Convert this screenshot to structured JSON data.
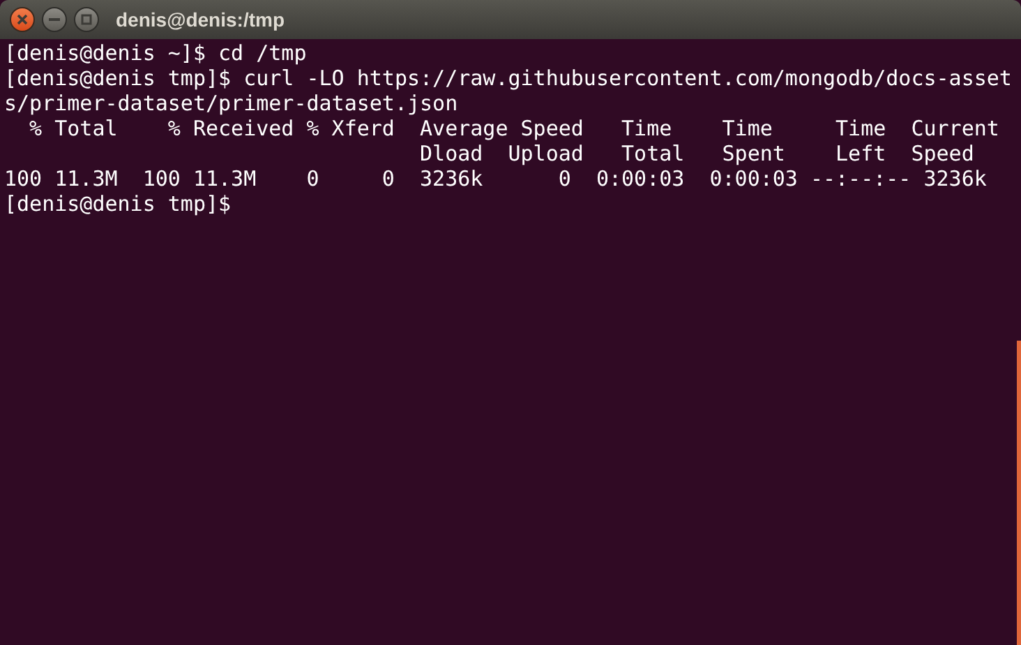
{
  "window": {
    "title": "denis@denis:/tmp"
  },
  "terminal": {
    "lines": [
      "[denis@denis ~]$ cd /tmp",
      "[denis@denis tmp]$ curl -LO https://raw.githubusercontent.com/mongodb/docs-asset",
      "s/primer-dataset/primer-dataset.json",
      "  % Total    % Received % Xferd  Average Speed   Time    Time     Time  Current",
      "                                 Dload  Upload   Total   Spent    Left  Speed",
      "100 11.3M  100 11.3M    0     0  3236k      0  0:00:03  0:00:03 --:--:-- 3236k",
      "[denis@denis tmp]$"
    ]
  }
}
